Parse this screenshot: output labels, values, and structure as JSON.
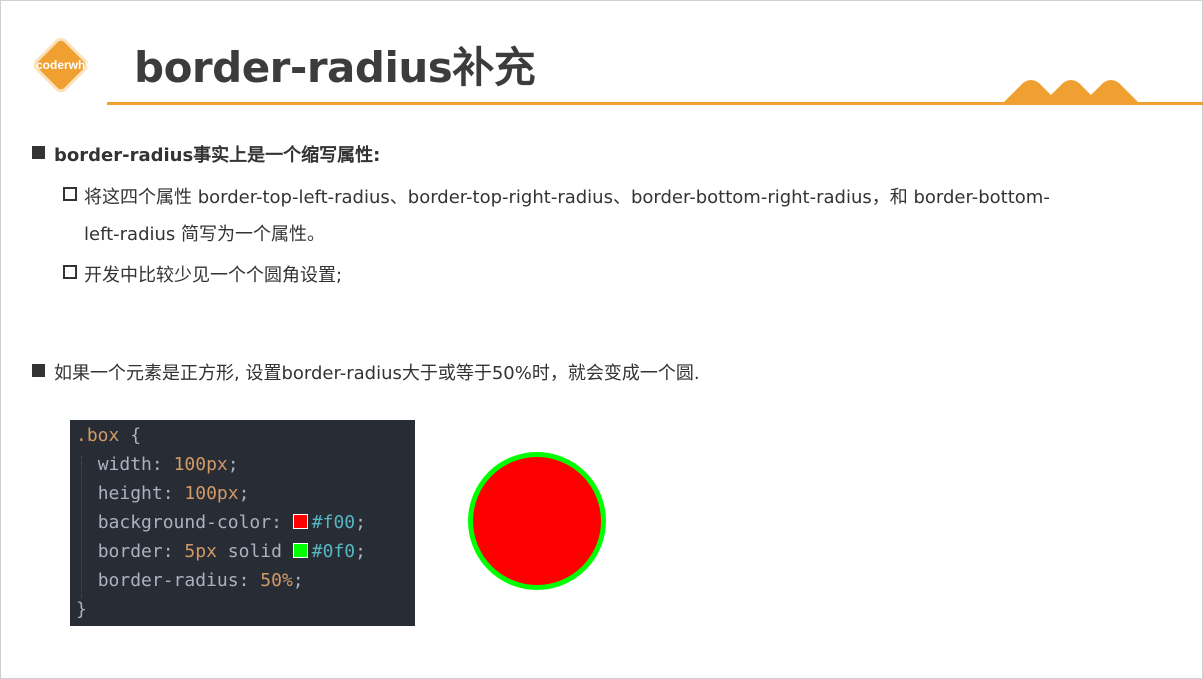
{
  "header": {
    "logo_text": "coderwhy",
    "title": "border-radius补充",
    "accent_color": "#f0a030"
  },
  "bullets": [
    {
      "text": "border-radius事实上是一个缩写属性:",
      "subitems": [
        {
          "line1": "将这四个属性 border-top-left-radius、border-top-right-radius、border-bottom-right-radius，和 border-bottom-",
          "line2": "left-radius 简写为一个属性。"
        },
        {
          "line1": "开发中比较少见一个个圆角设置;"
        }
      ]
    },
    {
      "text": "如果一个元素是正方形, 设置border-radius大于或等于50%时，就会变成一个圆."
    }
  ],
  "code": {
    "selector": ".box",
    "open_brace": "{",
    "close_brace": "}",
    "lines": [
      {
        "prop": "width",
        "value": "100px"
      },
      {
        "prop": "height",
        "value": "100px"
      },
      {
        "prop": "background-color",
        "value": "#f00",
        "swatch": "#ff0000"
      },
      {
        "prop": "border",
        "value_prefix": "5px",
        "value_keyword": "solid",
        "value": "#0f0",
        "swatch": "#00ff00"
      },
      {
        "prop": "border-radius",
        "value": "50%"
      }
    ]
  },
  "demo": {
    "fill_color": "#ff0000",
    "border_color": "#00ff00"
  }
}
